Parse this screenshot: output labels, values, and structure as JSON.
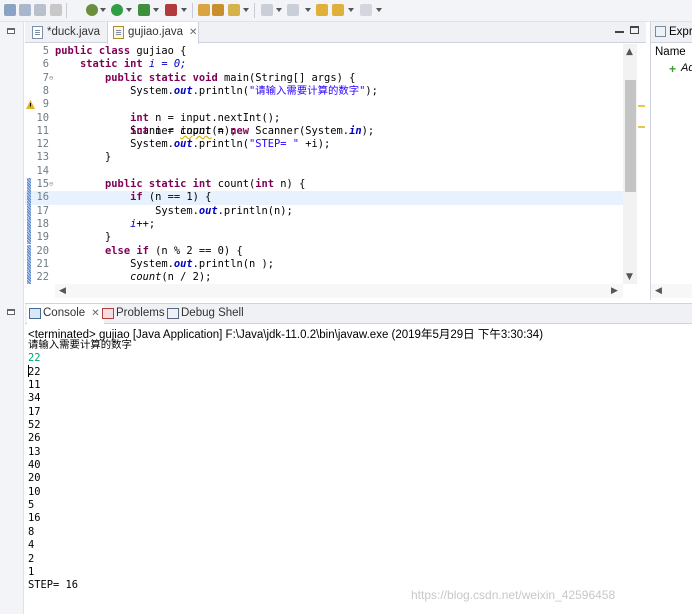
{
  "toolbar": {
    "icons": [
      "save-icon",
      "save-all-icon",
      "print-icon",
      "debug-icon",
      "run-icon",
      "coverage-icon",
      "external-tools-icon",
      "new-java-project-icon",
      "open-type-icon",
      "search-icon",
      "next-annotation-icon",
      "prev-annotation-icon",
      "back-icon",
      "forward-icon"
    ]
  },
  "editor": {
    "tabs": [
      {
        "label": "*duck.java",
        "active": false
      },
      {
        "label": "gujiao.java",
        "active": true
      }
    ],
    "lines": [
      {
        "num": "5"
      },
      {
        "num": "6"
      },
      {
        "num": "7"
      },
      {
        "num": "8"
      },
      {
        "num": "9"
      },
      {
        "num": "10"
      },
      {
        "num": "11"
      },
      {
        "num": "12"
      },
      {
        "num": "13"
      },
      {
        "num": "14"
      },
      {
        "num": "15"
      },
      {
        "num": "16"
      },
      {
        "num": "17"
      },
      {
        "num": "18"
      },
      {
        "num": "19"
      },
      {
        "num": "20"
      },
      {
        "num": "21"
      },
      {
        "num": "22"
      }
    ],
    "tokens": {
      "l5": [
        "public",
        "class",
        "gujiao {"
      ],
      "l6": [
        "static",
        "int",
        "i = 0;"
      ],
      "l7": [
        "public",
        "static",
        "void",
        "main(String[] args) {"
      ],
      "l8": [
        "System.",
        "out",
        ".println(",
        "\"请输入需要计算的数字\"",
        ");"
      ],
      "l9": [
        "Scanner ",
        "input",
        " = ",
        "new",
        " Scanner(System.",
        "in",
        ");"
      ],
      "l10": [
        "int",
        " n = ",
        "input",
        ".nextInt();"
      ],
      "l11": [
        "int",
        " i = ",
        "count",
        "(n);"
      ],
      "l12": [
        "System.",
        "out",
        ".println(",
        "\"STEP= \"",
        " +i);"
      ],
      "l13": [
        "}"
      ],
      "l15": [
        "public",
        "static",
        "int",
        "count(",
        "int",
        " n) {"
      ],
      "l16": [
        "if",
        " (n == 1) {"
      ],
      "l17": [
        "System.",
        "out",
        ".println(n);"
      ],
      "l18": [
        "i",
        "++;"
      ],
      "l19": [
        "}"
      ],
      "l20": [
        "else",
        "if",
        " (n % 2 == 0) {"
      ],
      "l21": [
        "System.",
        "out",
        ".println(n );"
      ],
      "l22": [
        "count",
        "(n / 2);"
      ]
    }
  },
  "right_pane": {
    "tab_label": "Expre",
    "column_header": "Name",
    "add_label": "Ad"
  },
  "console": {
    "tabs": [
      {
        "label": "Console",
        "active": true
      },
      {
        "label": "Problems",
        "active": false
      },
      {
        "label": "Debug Shell",
        "active": false
      }
    ],
    "terminated_line": "<terminated> gujiao [Java Application] F:\\Java\\jdk-11.0.2\\bin\\javaw.exe (2019年5月29日 下午3:30:34)",
    "output": [
      "请输入需要计算的数字",
      "22",
      "22",
      "11",
      "34",
      "17",
      "52",
      "26",
      "13",
      "40",
      "20",
      "10",
      "5",
      "16",
      "8",
      "4",
      "2",
      "1",
      "STEP= 16"
    ]
  },
  "watermark": "https://blog.csdn.net/weixin_42596458",
  "colors": {
    "keyword": "#7f0055",
    "string": "#2a00ff",
    "field": "#0000c0",
    "user_input": "#00a86b",
    "line_number": "#6f7c86",
    "current_line": "#e8f2fe"
  }
}
